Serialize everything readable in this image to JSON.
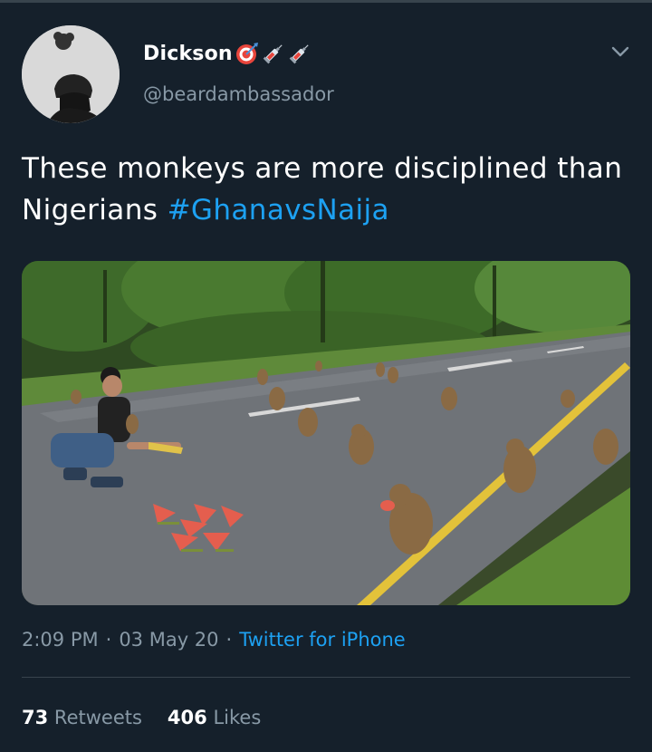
{
  "tweet": {
    "display_name": "Dickson",
    "name_emojis": [
      "target-emoji",
      "syringe-emoji",
      "syringe-emoji"
    ],
    "handle": "@beardambassador",
    "text_part1": "These monkeys are more disciplined than Nigerians ",
    "hashtag": "#GhanavsNaija",
    "time": "2:09 PM",
    "separator": "·",
    "date": "03 May 20",
    "source": "Twitter for iPhone",
    "retweets_count": "73",
    "retweets_label": "Retweets",
    "likes_count": "406",
    "likes_label": "Likes"
  },
  "colors": {
    "background": "#15202b",
    "accent": "#1da1f2",
    "secondary_text": "#8899a6",
    "divider": "#38444d"
  }
}
